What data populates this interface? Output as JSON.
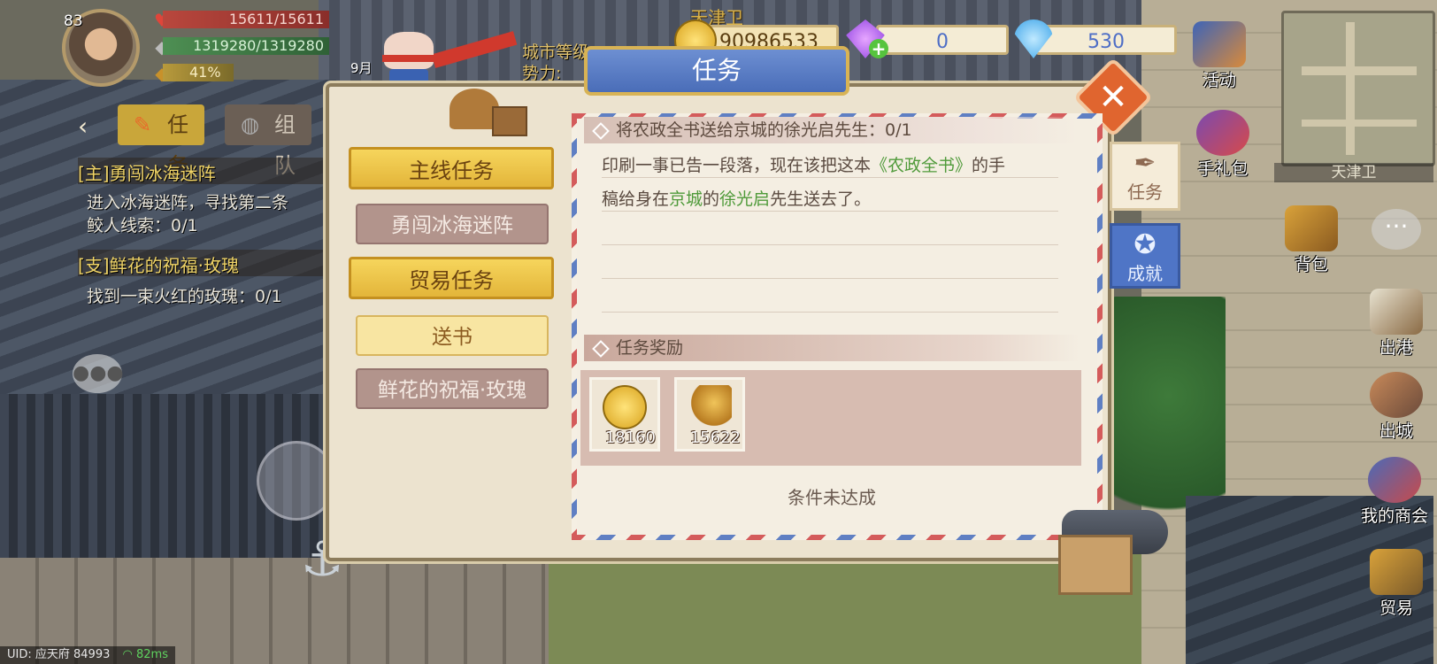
{
  "player": {
    "level": "83",
    "hp": "15611/15611",
    "sp": "1319280/1319280",
    "pct": "41%"
  },
  "location": {
    "city": "天津卫",
    "city_level_label": "城市等级: ",
    "power_label": "势力: ",
    "date": "9月"
  },
  "currency": {
    "gold": "90986533",
    "gems": "0",
    "diamonds": "530"
  },
  "tracker": {
    "tabs": [
      {
        "label": "任务"
      },
      {
        "label": "组队"
      }
    ],
    "quests": [
      {
        "title": "[主]勇闯冰海迷阵",
        "desc_line1": "进入冰海迷阵，寻找第二条",
        "desc_line2": "鲛人线索：0/1"
      },
      {
        "title": "[支]鲜花的祝福·玫瑰",
        "desc_line1": "找到一束火红的玫瑰：0/1"
      }
    ]
  },
  "panel": {
    "title": "任务",
    "categories": [
      {
        "label": "主线任务"
      },
      {
        "label": "勇闯冰海迷阵"
      },
      {
        "label": "贸易任务"
      },
      {
        "label": "送书"
      },
      {
        "label": "鲜花的祝福·玫瑰"
      }
    ],
    "selected_category": "送书",
    "task": {
      "header": "将农政全书送给京城的徐光启先生：0/1",
      "desc_part1": "印刷一事已告一段落，现在该把这本",
      "desc_hl1": "《农政全书》",
      "desc_part2": "的手",
      "desc_part3": "稿给身在",
      "desc_hl2": "京城",
      "desc_part4": "的",
      "desc_hl3": "徐光启",
      "desc_part5": "先生送去了。"
    },
    "reward_header": "任务奖励",
    "rewards": [
      {
        "icon": "gold-coin-icon",
        "qty": "18160"
      },
      {
        "icon": "trumpet-icon",
        "qty": "15622"
      }
    ],
    "status": "条件未达成"
  },
  "side_tabs": [
    {
      "label": "任务"
    },
    {
      "label": "成就"
    }
  ],
  "right_buttons": [
    {
      "label": "活动"
    },
    {
      "label": "手礼包"
    },
    {
      "label": "背包"
    },
    {
      "label": "出港"
    },
    {
      "label": "出城"
    },
    {
      "label": "我的商会"
    },
    {
      "label": "贸易"
    }
  ],
  "minimap": {
    "label": "天津卫"
  },
  "footer": {
    "uid": "UID: 应天府 84993",
    "ping": "82ms"
  },
  "colors": {
    "accent_blue": "#4f75c6",
    "gold": "#e3b53a",
    "close_orange": "#e0652f",
    "highlight_green": "#4f9a3a"
  }
}
